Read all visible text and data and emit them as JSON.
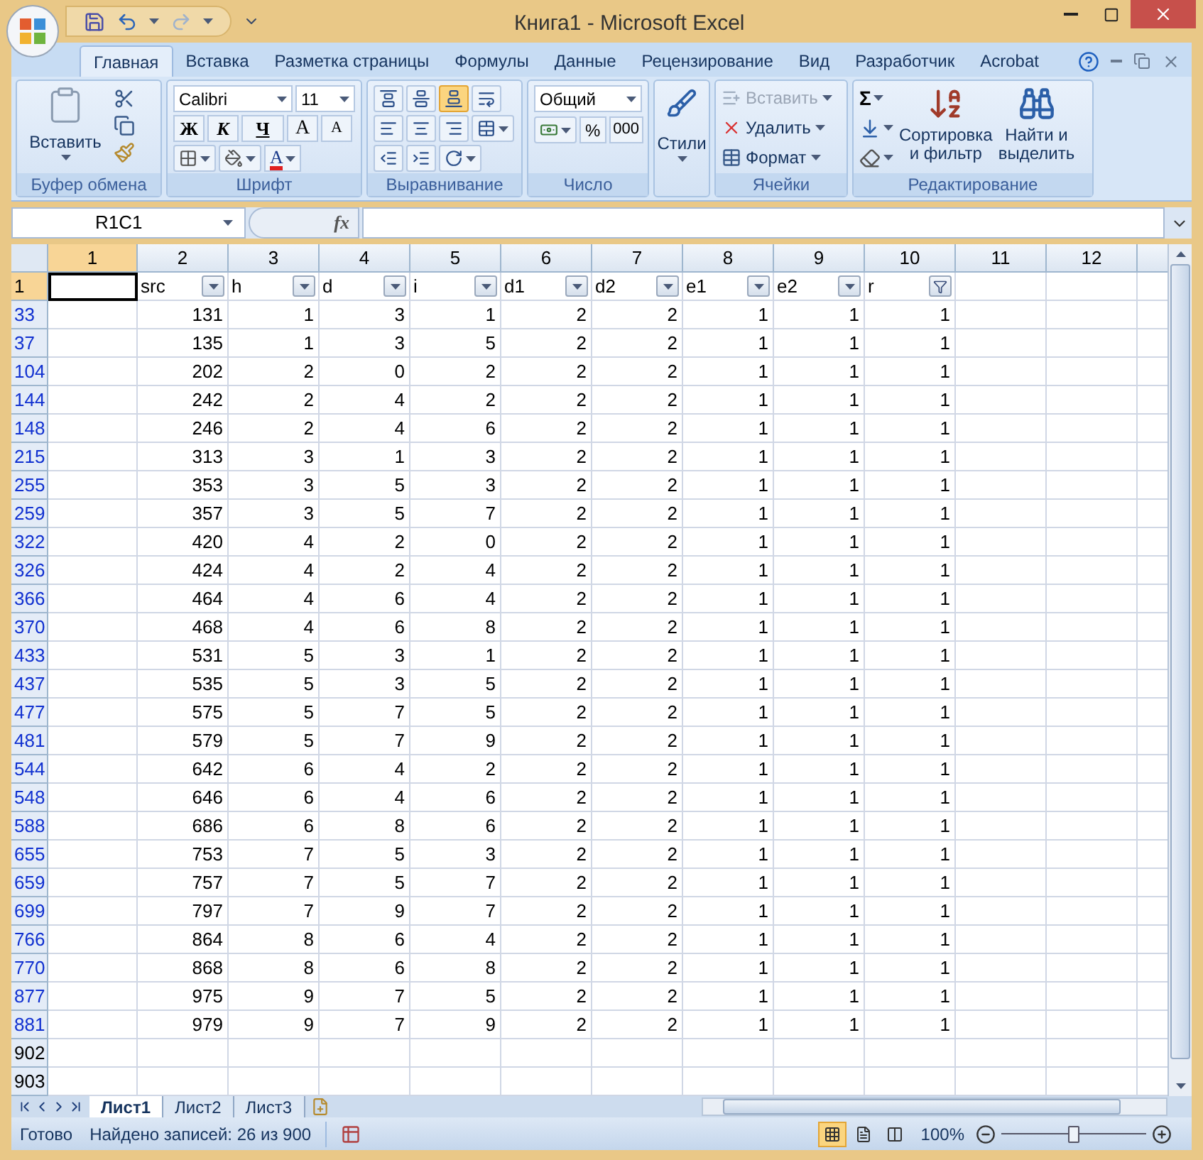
{
  "window": {
    "title": "Книга1 - Microsoft Excel"
  },
  "tabs": [
    {
      "label": "Главная",
      "selected": true
    },
    {
      "label": "Вставка",
      "selected": false
    },
    {
      "label": "Разметка страницы",
      "selected": false
    },
    {
      "label": "Формулы",
      "selected": false
    },
    {
      "label": "Данные",
      "selected": false
    },
    {
      "label": "Рецензирование",
      "selected": false
    },
    {
      "label": "Вид",
      "selected": false
    },
    {
      "label": "Разработчик",
      "selected": false
    },
    {
      "label": "Acrobat",
      "selected": false
    }
  ],
  "ribbon": {
    "clipboard": {
      "title": "Буфер обмена",
      "paste": "Вставить"
    },
    "font": {
      "title": "Шрифт",
      "font_name": "Calibri",
      "font_size": "11",
      "bold": "Ж",
      "italic": "К",
      "underline": "Ч",
      "grow": "A",
      "shrink": "A",
      "font_color": "A"
    },
    "alignment": {
      "title": "Выравнивание",
      "vertical": [
        {
          "selected": false
        },
        {
          "selected": false
        },
        {
          "selected": true
        }
      ]
    },
    "number": {
      "title": "Число",
      "format": "Общий",
      "percent": "%",
      "thousands": "000"
    },
    "styles": {
      "label": "Стили"
    },
    "cells": {
      "title": "Ячейки",
      "items": [
        {
          "label": "Вставить",
          "disabled": true
        },
        {
          "label": "Удалить",
          "disabled": false
        },
        {
          "label": "Формат",
          "disabled": false
        }
      ]
    },
    "editing": {
      "title": "Редактирование",
      "sum": "Σ",
      "sort": [
        "Сортировка",
        "и фильтр"
      ],
      "find": [
        "Найти и",
        "выделить"
      ]
    }
  },
  "formula_bar": {
    "name_box": "R1C1",
    "fx": "fx"
  },
  "column_headers": [
    {
      "label": "1",
      "selected": true
    },
    {
      "label": "2",
      "selected": false
    },
    {
      "label": "3",
      "selected": false
    },
    {
      "label": "4",
      "selected": false
    },
    {
      "label": "5",
      "selected": false
    },
    {
      "label": "6",
      "selected": false
    },
    {
      "label": "7",
      "selected": false
    },
    {
      "label": "8",
      "selected": false
    },
    {
      "label": "9",
      "selected": false
    },
    {
      "label": "10",
      "selected": false
    },
    {
      "label": "11",
      "selected": false
    },
    {
      "label": "12",
      "selected": false
    }
  ],
  "header_row": {
    "header": "1",
    "selected": true,
    "columns": [
      {
        "label": "src",
        "filtered": false
      },
      {
        "label": "h",
        "filtered": false
      },
      {
        "label": "d",
        "filtered": false
      },
      {
        "label": "i",
        "filtered": false
      },
      {
        "label": "d1",
        "filtered": false
      },
      {
        "label": "d2",
        "filtered": false
      },
      {
        "label": "e1",
        "filtered": false
      },
      {
        "label": "e2",
        "filtered": false
      },
      {
        "label": "r",
        "filtered": true
      }
    ]
  },
  "rows": [
    {
      "header": "33",
      "cells": [
        "131",
        "1",
        "3",
        "1",
        "2",
        "2",
        "1",
        "1",
        "1"
      ]
    },
    {
      "header": "37",
      "cells": [
        "135",
        "1",
        "3",
        "5",
        "2",
        "2",
        "1",
        "1",
        "1"
      ]
    },
    {
      "header": "104",
      "cells": [
        "202",
        "2",
        "0",
        "2",
        "2",
        "2",
        "1",
        "1",
        "1"
      ]
    },
    {
      "header": "144",
      "cells": [
        "242",
        "2",
        "4",
        "2",
        "2",
        "2",
        "1",
        "1",
        "1"
      ]
    },
    {
      "header": "148",
      "cells": [
        "246",
        "2",
        "4",
        "6",
        "2",
        "2",
        "1",
        "1",
        "1"
      ]
    },
    {
      "header": "215",
      "cells": [
        "313",
        "3",
        "1",
        "3",
        "2",
        "2",
        "1",
        "1",
        "1"
      ]
    },
    {
      "header": "255",
      "cells": [
        "353",
        "3",
        "5",
        "3",
        "2",
        "2",
        "1",
        "1",
        "1"
      ]
    },
    {
      "header": "259",
      "cells": [
        "357",
        "3",
        "5",
        "7",
        "2",
        "2",
        "1",
        "1",
        "1"
      ]
    },
    {
      "header": "322",
      "cells": [
        "420",
        "4",
        "2",
        "0",
        "2",
        "2",
        "1",
        "1",
        "1"
      ]
    },
    {
      "header": "326",
      "cells": [
        "424",
        "4",
        "2",
        "4",
        "2",
        "2",
        "1",
        "1",
        "1"
      ]
    },
    {
      "header": "366",
      "cells": [
        "464",
        "4",
        "6",
        "4",
        "2",
        "2",
        "1",
        "1",
        "1"
      ]
    },
    {
      "header": "370",
      "cells": [
        "468",
        "4",
        "6",
        "8",
        "2",
        "2",
        "1",
        "1",
        "1"
      ]
    },
    {
      "header": "433",
      "cells": [
        "531",
        "5",
        "3",
        "1",
        "2",
        "2",
        "1",
        "1",
        "1"
      ]
    },
    {
      "header": "437",
      "cells": [
        "535",
        "5",
        "3",
        "5",
        "2",
        "2",
        "1",
        "1",
        "1"
      ]
    },
    {
      "header": "477",
      "cells": [
        "575",
        "5",
        "7",
        "5",
        "2",
        "2",
        "1",
        "1",
        "1"
      ]
    },
    {
      "header": "481",
      "cells": [
        "579",
        "5",
        "7",
        "9",
        "2",
        "2",
        "1",
        "1",
        "1"
      ]
    },
    {
      "header": "544",
      "cells": [
        "642",
        "6",
        "4",
        "2",
        "2",
        "2",
        "1",
        "1",
        "1"
      ]
    },
    {
      "header": "548",
      "cells": [
        "646",
        "6",
        "4",
        "6",
        "2",
        "2",
        "1",
        "1",
        "1"
      ]
    },
    {
      "header": "588",
      "cells": [
        "686",
        "6",
        "8",
        "6",
        "2",
        "2",
        "1",
        "1",
        "1"
      ]
    },
    {
      "header": "655",
      "cells": [
        "753",
        "7",
        "5",
        "3",
        "2",
        "2",
        "1",
        "1",
        "1"
      ]
    },
    {
      "header": "659",
      "cells": [
        "757",
        "7",
        "5",
        "7",
        "2",
        "2",
        "1",
        "1",
        "1"
      ]
    },
    {
      "header": "699",
      "cells": [
        "797",
        "7",
        "9",
        "7",
        "2",
        "2",
        "1",
        "1",
        "1"
      ]
    },
    {
      "header": "766",
      "cells": [
        "864",
        "8",
        "6",
        "4",
        "2",
        "2",
        "1",
        "1",
        "1"
      ]
    },
    {
      "header": "770",
      "cells": [
        "868",
        "8",
        "6",
        "8",
        "2",
        "2",
        "1",
        "1",
        "1"
      ]
    },
    {
      "header": "877",
      "cells": [
        "975",
        "9",
        "7",
        "5",
        "2",
        "2",
        "1",
        "1",
        "1"
      ]
    },
    {
      "header": "881",
      "cells": [
        "979",
        "9",
        "7",
        "9",
        "2",
        "2",
        "1",
        "1",
        "1"
      ]
    }
  ],
  "empty_rows": [
    "902",
    "903"
  ],
  "sheet_tabs": [
    {
      "label": "Лист1",
      "selected": true
    },
    {
      "label": "Лист2",
      "selected": false
    },
    {
      "label": "Лист3",
      "selected": false
    }
  ],
  "status_bar": {
    "ready": "Готово",
    "filter_info": "Найдено записей: 26 из 900",
    "zoom": "100%",
    "zoom_slider": {
      "level": 0.5
    }
  }
}
